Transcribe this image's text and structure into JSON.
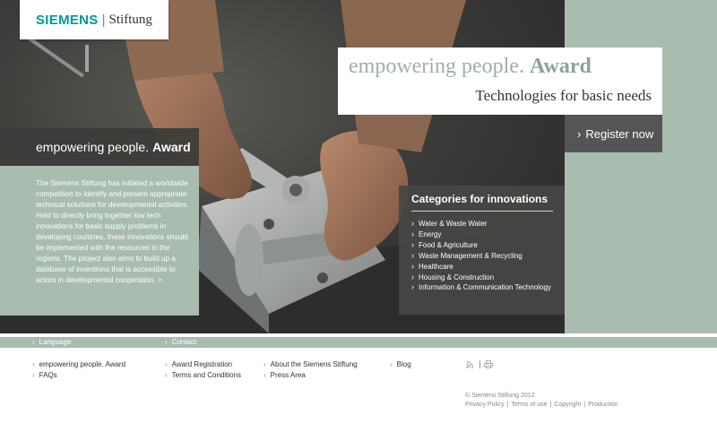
{
  "logo": {
    "brand": "SIEMENS",
    "name": "Stiftung"
  },
  "hero": {
    "award_light": "empowering people.",
    "award_bold": "Award",
    "subtitle": "Technologies for basic needs",
    "register_label": "Register now"
  },
  "intro": {
    "title_light": "empowering people.",
    "title_bold": "Award",
    "text": "The Siemens Stiftung has initiated a worldwide competition to identify and present appropriate technical solutions for developmental activities. Held to directly bring together low tech innovations for basic supply problems in developing countries, these innovations should be implemented with the resources in the regions. The project also aims to build up a database of inventions that is accessible to actors in developmental cooperation.",
    "more": ">"
  },
  "categories": {
    "title": "Categories for innovations",
    "items": [
      "Water & Waste Water",
      "Energy",
      "Food & Agriculture",
      "Waste Management & Recycling",
      "Healthcare",
      "Housing & Construction",
      "Information & Communication Technology"
    ]
  },
  "footer": {
    "bar": {
      "language": "Language",
      "contact": "Contact"
    },
    "links": {
      "empowering": "empowering people. Award",
      "faqs": "FAQs",
      "registration": "Award Registration",
      "terms": "Terms and Conditions",
      "about": "About the Siemens Stiftung",
      "press": "Press Area",
      "blog": "Blog"
    },
    "copyright": "© Siemens Stiftung 2012",
    "legal": [
      "Privacy Policy",
      "Terms of use",
      "Copyright",
      "Production"
    ]
  },
  "icons": {
    "rss": "rss-icon",
    "print": "print-icon"
  },
  "colors": {
    "brand_teal": "#009999",
    "sage": "#a8bcb0",
    "dark_panel": "#555555"
  }
}
